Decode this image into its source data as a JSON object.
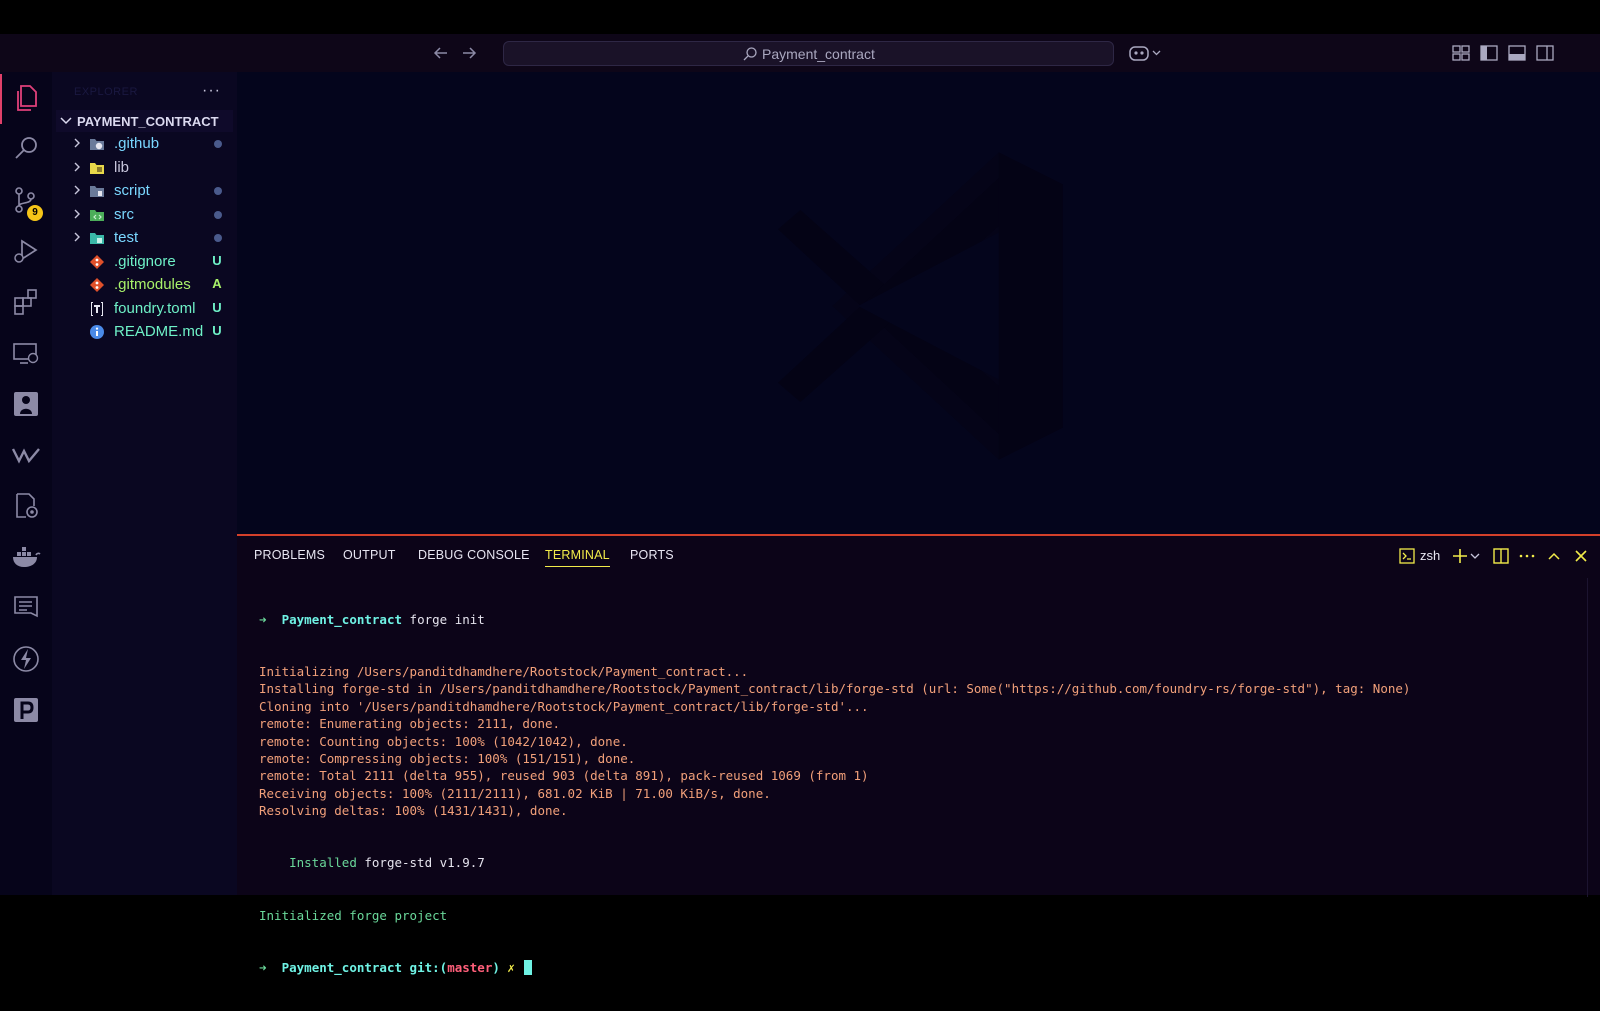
{
  "window": {
    "search_text": "Payment_contract"
  },
  "explorer": {
    "title": "EXPLORER",
    "more": "···",
    "section": "PAYMENT_CONTRACT",
    "items": [
      {
        "name": ".github",
        "type": "folder",
        "status": "",
        "color": "#7ad7ff"
      },
      {
        "name": "lib",
        "type": "folder",
        "status": "",
        "color": "#c8c6dc"
      },
      {
        "name": "script",
        "type": "folder",
        "status": "",
        "color": "#7ad7ff"
      },
      {
        "name": "src",
        "type": "folder",
        "status": "",
        "color": "#7ad7ff"
      },
      {
        "name": "test",
        "type": "folder",
        "status": "",
        "color": "#7ad7ff"
      },
      {
        "name": ".gitignore",
        "type": "file",
        "status": "U",
        "color": "#6ff2c8"
      },
      {
        "name": ".gitmodules",
        "type": "file",
        "status": "A",
        "color": "#a8f26a"
      },
      {
        "name": "foundry.toml",
        "type": "file",
        "status": "U",
        "color": "#6ff2c8"
      },
      {
        "name": "README.md",
        "type": "file",
        "status": "U",
        "color": "#6ff2c8"
      }
    ]
  },
  "activity": {
    "scm_badge": "9"
  },
  "panel": {
    "tabs": [
      "PROBLEMS",
      "OUTPUT",
      "DEBUG CONSOLE",
      "TERMINAL",
      "PORTS"
    ],
    "active_tab": "TERMINAL",
    "shell": "zsh"
  },
  "terminal": {
    "prompt_arrow": "➜",
    "cmd_dir": "Payment_contract",
    "cmd": "forge init",
    "output": [
      "Initializing /Users/panditdhamdhere/Rootstock/Payment_contract...",
      "Installing forge-std in /Users/panditdhamdhere/Rootstock/Payment_contract/lib/forge-std (url: Some(\"https://github.com/foundry-rs/forge-std\"), tag: None)",
      "Cloning into '/Users/panditdhamdhere/Rootstock/Payment_contract/lib/forge-std'...",
      "remote: Enumerating objects: 2111, done.",
      "remote: Counting objects: 100% (1042/1042), done.",
      "remote: Compressing objects: 100% (151/151), done.",
      "remote: Total 2111 (delta 955), reused 903 (delta 891), pack-reused 1069 (from 1)",
      "Receiving objects: 100% (2111/2111), 681.02 KiB | 71.00 KiB/s, done.",
      "Resolving deltas: 100% (1431/1431), done."
    ],
    "installed_word": "Installed",
    "installed_rest": "forge-std v1.9.7",
    "initialized": "Initialized forge project",
    "prompt2_dir": "Payment_contract",
    "git_label": "git:(",
    "branch": "master",
    "git_close": ")",
    "dirty": "✗"
  },
  "colors": {
    "accent": "#e0406a",
    "panel_border": "#d4402a",
    "terminal_output": "#f2a07a",
    "terminal_success": "#6ad89a",
    "terminal_prompt": "#6ff2e4"
  }
}
